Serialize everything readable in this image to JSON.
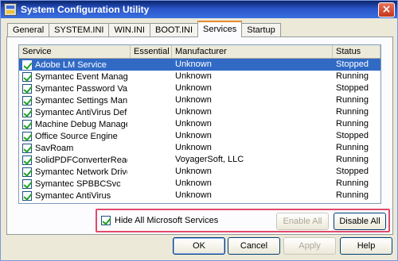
{
  "window": {
    "title": "System Configuration Utility",
    "close_glyph": "×"
  },
  "tabs": [
    {
      "label": "General",
      "active": false
    },
    {
      "label": "SYSTEM.INI",
      "active": false
    },
    {
      "label": "WIN.INI",
      "active": false
    },
    {
      "label": "BOOT.INI",
      "active": false
    },
    {
      "label": "Services",
      "active": true
    },
    {
      "label": "Startup",
      "active": false
    }
  ],
  "list": {
    "columns": [
      "Service",
      "Essential",
      "Manufacturer",
      "Status"
    ],
    "rows": [
      {
        "service": "Adobe LM Service",
        "essential": "",
        "manufacturer": "Unknown",
        "status": "Stopped",
        "checked": true,
        "selected": true
      },
      {
        "service": "Symantec Event Manager",
        "essential": "",
        "manufacturer": "Unknown",
        "status": "Running",
        "checked": true,
        "selected": false
      },
      {
        "service": "Symantec Password Vali...",
        "essential": "",
        "manufacturer": "Unknown",
        "status": "Stopped",
        "checked": true,
        "selected": false
      },
      {
        "service": "Symantec Settings Mana...",
        "essential": "",
        "manufacturer": "Unknown",
        "status": "Running",
        "checked": true,
        "selected": false
      },
      {
        "service": "Symantec AntiVirus Defi...",
        "essential": "",
        "manufacturer": "Unknown",
        "status": "Running",
        "checked": true,
        "selected": false
      },
      {
        "service": "Machine Debug Manager",
        "essential": "",
        "manufacturer": "Unknown",
        "status": "Running",
        "checked": true,
        "selected": false
      },
      {
        "service": "Office Source Engine",
        "essential": "",
        "manufacturer": "Unknown",
        "status": "Stopped",
        "checked": true,
        "selected": false
      },
      {
        "service": "SavRoam",
        "essential": "",
        "manufacturer": "Unknown",
        "status": "Running",
        "checked": true,
        "selected": false
      },
      {
        "service": "SolidPDFConverterRead...",
        "essential": "",
        "manufacturer": "VoyagerSoft, LLC",
        "status": "Running",
        "checked": true,
        "selected": false
      },
      {
        "service": "Symantec Network Drive...",
        "essential": "",
        "manufacturer": "Unknown",
        "status": "Stopped",
        "checked": true,
        "selected": false
      },
      {
        "service": "Symantec SPBBCSvc",
        "essential": "",
        "manufacturer": "Unknown",
        "status": "Running",
        "checked": true,
        "selected": false
      },
      {
        "service": "Symantec AntiVirus",
        "essential": "",
        "manufacturer": "Unknown",
        "status": "Running",
        "checked": true,
        "selected": false
      }
    ]
  },
  "hide_ms": {
    "label": "Hide All Microsoft Services",
    "checked": true
  },
  "buttons": {
    "enable_all": "Enable All",
    "disable_all": "Disable All",
    "ok": "OK",
    "cancel": "Cancel",
    "apply": "Apply",
    "help": "Help"
  },
  "colors": {
    "selection": "#316ac5",
    "highlight_border": "#e04a6a",
    "active_tab_accent": "#e68b2c"
  }
}
